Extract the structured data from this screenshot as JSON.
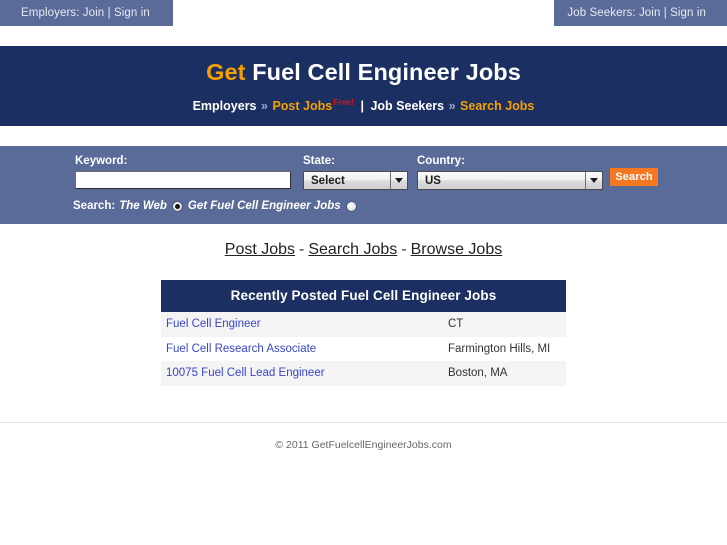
{
  "topbar": {
    "employers_text": "Employers: Join | Sign in",
    "employers_label": "Employers:",
    "employers_join": "Join",
    "employers_signin": "Sign in",
    "jobseekers_text": "Job Seekers: Join | Sign in",
    "jobseekers_label": "Job Seekers:",
    "jobseekers_join": "Join",
    "jobseekers_signin": "Sign in",
    "separator": "|",
    "bg_color": "#5a6b99"
  },
  "banner": {
    "title_accent": "Get",
    "title_rest": " Fuel Cell Engineer Jobs",
    "bg_color": "#1b2f62",
    "accent_color": "#f5a000",
    "subnav": {
      "employers": "Employers",
      "chevron": "»",
      "post_jobs": "Post Jobs",
      "free_badge": "Free!",
      "free_color": "#e01010",
      "pipe": "|",
      "job_seekers": "Job Seekers",
      "search_jobs": "Search Jobs"
    }
  },
  "search": {
    "keyword_label": "Keyword:",
    "keyword_value": "",
    "keyword_placeholder": "",
    "state_label": "State:",
    "state_value": "Select",
    "country_label": "Country:",
    "country_value": "US",
    "search_button": "Search",
    "search_button_color": "#f47721",
    "scope_label": "Search:",
    "scope_option_web": "The Web",
    "scope_option_site": "Get Fuel Cell Engineer Jobs",
    "scope_web_selected": true,
    "scope_site_selected": false
  },
  "nav": {
    "separator": "-",
    "links": [
      {
        "label": "Post Jobs"
      },
      {
        "label": "Search Jobs"
      },
      {
        "label": "Browse Jobs"
      }
    ]
  },
  "jobs_table": {
    "heading": "Recently Posted Fuel Cell Engineer Jobs",
    "heading_bg": "#1b2f62",
    "link_color": "#3a46c8",
    "rows": [
      {
        "title": "Fuel Cell Engineer",
        "location": "CT"
      },
      {
        "title": "Fuel Cell Research Associate",
        "location": "Farmington Hills, MI"
      },
      {
        "title": "10075 Fuel Cell Lead Engineer",
        "location": "Boston, MA"
      }
    ]
  },
  "footer": {
    "copyright": "© 2011 GetFuelcellEngineerJobs.com"
  }
}
